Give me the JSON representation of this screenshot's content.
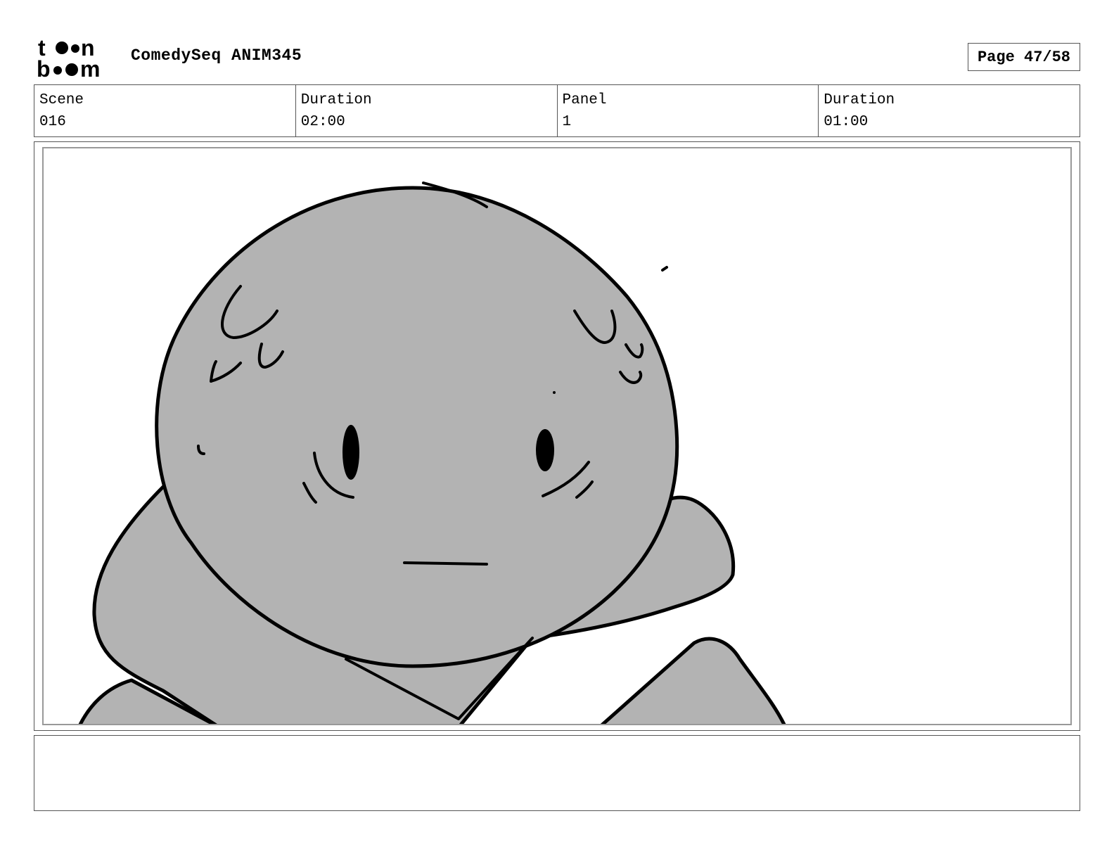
{
  "header": {
    "logo_line1": "toon",
    "logo_line2": "boom",
    "project_title": "ComedySeq ANIM345",
    "page_label": "Page 47/58"
  },
  "info": [
    {
      "label": "Scene",
      "value": "016"
    },
    {
      "label": "Duration",
      "value": "02:00"
    },
    {
      "label": "Panel",
      "value": "1"
    },
    {
      "label": "Duration",
      "value": "01:00"
    }
  ],
  "panel": {
    "fill_color": "#b3b3b3",
    "line_color": "#000000"
  },
  "notes": {
    "text": ""
  }
}
